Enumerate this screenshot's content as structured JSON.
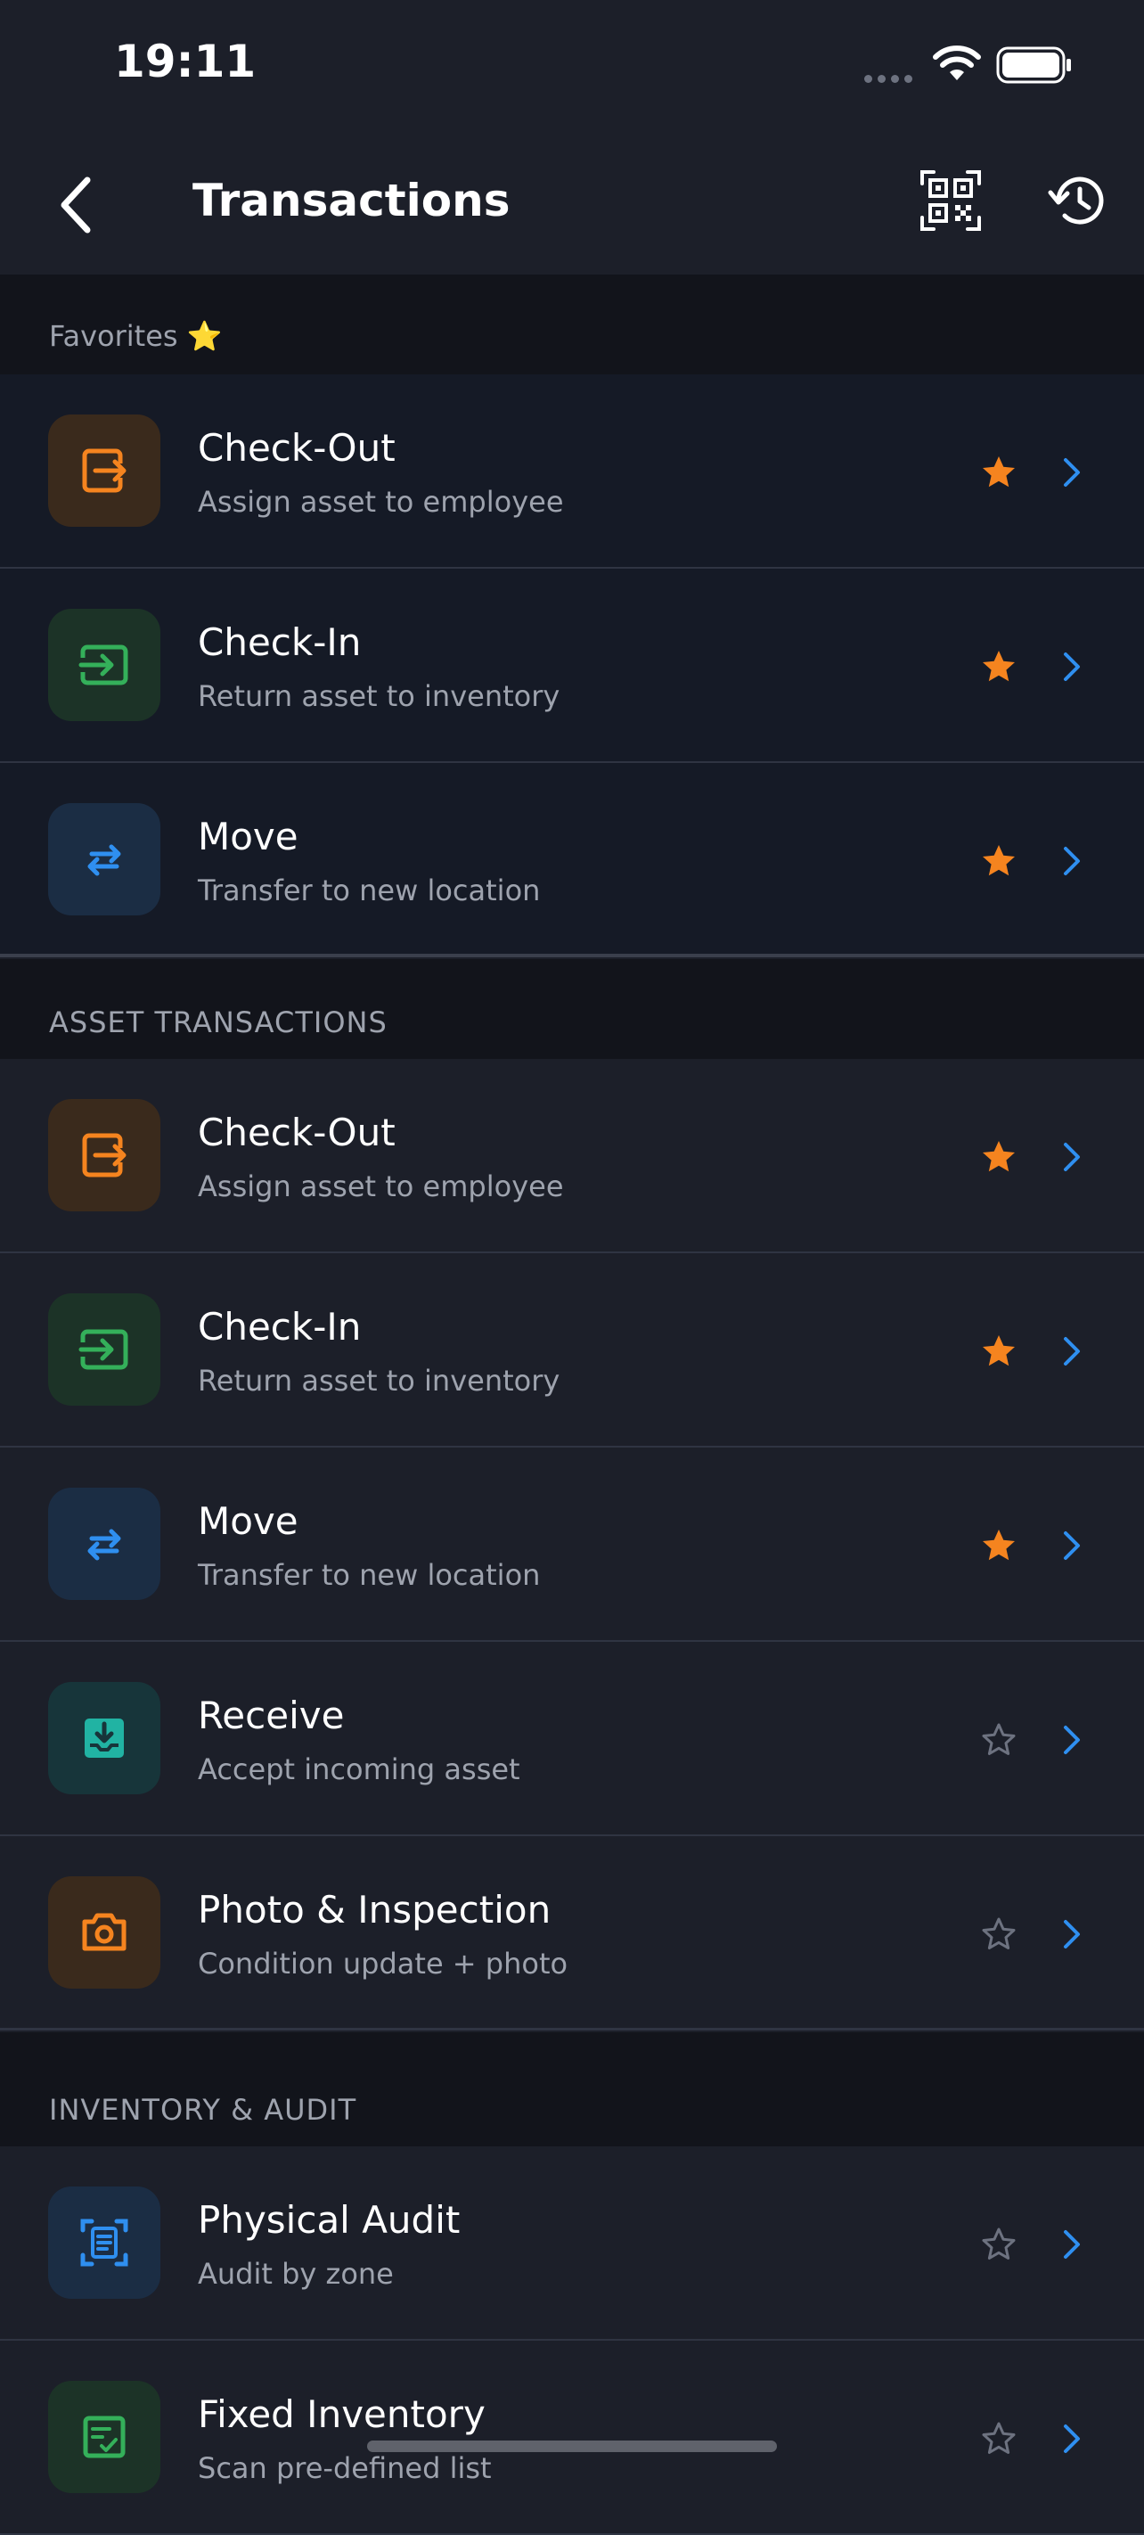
{
  "status_bar": {
    "time": "19:11"
  },
  "header": {
    "title": "Transactions",
    "back_icon": "chevron-left-icon",
    "qr_icon": "qr-code-scan-icon",
    "history_icon": "history-icon"
  },
  "colors": {
    "background": "#1c1f29",
    "section_bg": "#12141b",
    "favorites_row_bg": "#151a26",
    "accent_orange": "#f5841f",
    "accent_green": "#34b05a",
    "accent_blue": "#2f8ff0",
    "accent_teal": "#21b3a3",
    "chevron_blue": "#2f8ff0"
  },
  "favorites": {
    "title": "Favorites ⭐",
    "items": [
      {
        "title": "Check-Out",
        "subtitle": "Assign asset to employee",
        "icon": "check-out-icon",
        "favorite": true
      },
      {
        "title": "Check-In",
        "subtitle": "Return asset to inventory",
        "icon": "check-in-icon",
        "favorite": true
      },
      {
        "title": "Move",
        "subtitle": "Transfer to new location",
        "icon": "move-arrows-icon",
        "favorite": true
      }
    ]
  },
  "asset_transactions": {
    "title": "ASSET TRANSACTIONS",
    "items": [
      {
        "title": "Check-Out",
        "subtitle": "Assign asset to employee",
        "icon": "check-out-icon",
        "favorite": true
      },
      {
        "title": "Check-In",
        "subtitle": "Return asset to inventory",
        "icon": "check-in-icon",
        "favorite": true
      },
      {
        "title": "Move",
        "subtitle": "Transfer to new location",
        "icon": "move-arrows-icon",
        "favorite": true
      },
      {
        "title": "Receive",
        "subtitle": "Accept incoming asset",
        "icon": "receive-inbox-icon",
        "favorite": false
      },
      {
        "title": "Photo & Inspection",
        "subtitle": "Condition update + photo",
        "icon": "camera-icon",
        "favorite": false
      }
    ]
  },
  "inventory_audit": {
    "title": "INVENTORY & AUDIT",
    "items": [
      {
        "title": "Physical Audit",
        "subtitle": "Audit by zone",
        "icon": "audit-scan-icon",
        "favorite": false
      },
      {
        "title": "Fixed Inventory",
        "subtitle": "Scan pre-defined list",
        "icon": "checklist-icon",
        "favorite": false
      }
    ]
  }
}
